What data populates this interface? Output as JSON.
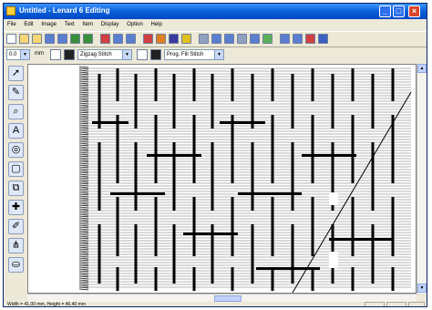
{
  "window": {
    "title": "Untitled - Lenard 6 Editing"
  },
  "titlebar_buttons": [
    "minimize-button",
    "maximize-button",
    "close-button"
  ],
  "menu": [
    "File",
    "Edit",
    "Image",
    "Text",
    "Item",
    "Display",
    "Option",
    "Help"
  ],
  "toolbar1_icons": [
    "new-icon",
    "open-icon",
    "open-design-icon",
    "save-icon",
    "save-as-icon",
    "undo-icon",
    "redo-icon",
    "cut-icon",
    "copy-icon",
    "paste-icon",
    "stitch-icon",
    "color-icon",
    "object-icon",
    "sparkle-icon",
    "grid-icon",
    "zoom-in-icon",
    "zoom-out-icon",
    "pan-icon",
    "zoom-fit-icon",
    "preview-icon",
    "view-icon",
    "monitor-icon",
    "settings-icon",
    "help-icon"
  ],
  "toolbar2": {
    "size_value": "0.0",
    "unit_label": "mm",
    "stitch_type_value": "Zigzag Stitch",
    "fill_type_value": "Prog. Fill Stitch"
  },
  "tools": [
    "select-arrow-icon",
    "node-edit-icon",
    "zoom-icon",
    "text-icon",
    "fill-icon",
    "shape-icon",
    "group-icon",
    "color-picker-icon",
    "pen-icon",
    "stitch-icon",
    "hoop-icon"
  ],
  "status": {
    "text": "Width = 41.00 mm, Height = 46.40 mm"
  },
  "colors": {
    "titlebar": "#0a5fd8",
    "canvas": "#ffffff",
    "stitch": "#000000",
    "fill_gray": "#c8c8c8"
  }
}
